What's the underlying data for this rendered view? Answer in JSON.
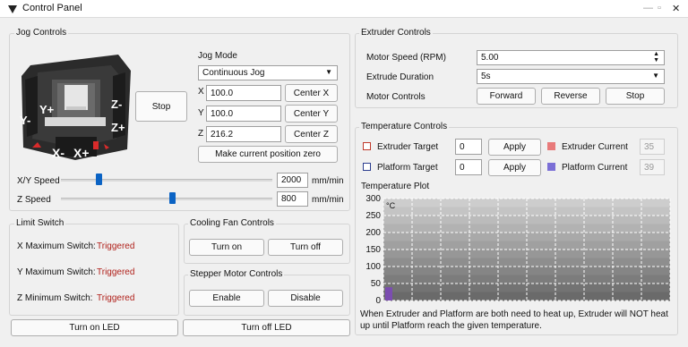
{
  "window": {
    "title": "Control Panel"
  },
  "jog": {
    "group_title": "Jog Controls",
    "mode_label": "Jog Mode",
    "mode_value": "Continuous Jog",
    "stop_label": "Stop",
    "x_label": "X",
    "x_value": "100.0",
    "center_x": "Center X",
    "y_label": "Y",
    "y_value": "100.0",
    "center_y": "Center Y",
    "z_label": "Z",
    "z_value": "216.2",
    "center_z": "Center Z",
    "zero_label": "Make current position zero",
    "xy_speed_label": "X/Y Speed",
    "xy_speed_value": "2000",
    "xy_unit": "mm/min",
    "xy_level": 0.17,
    "z_speed_label": "Z Speed",
    "z_speed_value": "800",
    "z_unit": "mm/min",
    "z_level": 0.53,
    "pad": {
      "y_minus": "Y-",
      "y_plus": "Y+",
      "x_minus": "X-",
      "x_plus": "X+",
      "z_minus": "Z-",
      "z_plus": "Z+"
    }
  },
  "limit": {
    "group_title": "Limit Switch",
    "rows": [
      {
        "label": "X Maximum Switch:",
        "value": "Triggered"
      },
      {
        "label": "Y Maximum Switch:",
        "value": "Triggered"
      },
      {
        "label": "Z Minimum Switch:",
        "value": "Triggered"
      }
    ]
  },
  "fan": {
    "group_title": "Cooling Fan Controls",
    "on": "Turn on",
    "off": "Turn off"
  },
  "stepper": {
    "group_title": "Stepper Motor Controls",
    "enable": "Enable",
    "disable": "Disable"
  },
  "led": {
    "on": "Turn on LED",
    "off": "Turn off LED"
  },
  "extruder": {
    "group_title": "Extruder Controls",
    "speed_label": "Motor Speed (RPM)",
    "speed_value": "5.00",
    "duration_label": "Extrude Duration",
    "duration_value": "5s",
    "controls_label": "Motor Controls",
    "forward": "Forward",
    "reverse": "Reverse",
    "stop": "Stop"
  },
  "temp": {
    "group_title": "Temperature Controls",
    "ext_target_label": "Extruder Target",
    "ext_target_value": "0",
    "apply": "Apply",
    "ext_current_label": "Extruder Current",
    "ext_current_value": "35",
    "plat_target_label": "Platform Target",
    "plat_target_value": "0",
    "plat_current_label": "Platform Current",
    "plat_current_value": "39",
    "plot_label": "Temperature Plot",
    "note": "When Extruder and Platform are both need to heat up, Extruder will NOT heat up until Platform reach the given temperature.",
    "colors": {
      "extruder_target": "#c0392b",
      "platform_target": "#2c3e8f",
      "extruder_current": "#e87a7a",
      "platform_current": "#7b6fd6"
    }
  },
  "chart_data": {
    "type": "bar",
    "unit_label": "°C",
    "ylim": [
      0,
      300
    ],
    "yticks": [
      "300",
      "250",
      "200",
      "150",
      "100",
      "50",
      "0"
    ],
    "series": [
      {
        "values": [
          39
        ]
      }
    ],
    "grid": true
  }
}
